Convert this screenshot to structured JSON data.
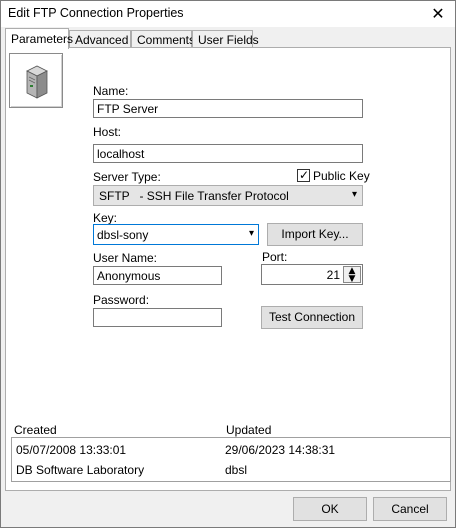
{
  "window": {
    "title": "Edit FTP Connection Properties",
    "close_glyph": "✕"
  },
  "tabs": [
    {
      "label": "Parameters",
      "active": true
    },
    {
      "label": "Advanced",
      "active": false
    },
    {
      "label": "Comments",
      "active": false
    },
    {
      "label": "User Fields",
      "active": false
    }
  ],
  "form": {
    "name_label": "Name:",
    "name_value": "FTP Server",
    "host_label": "Host:",
    "host_value": "localhost",
    "server_type_label": "Server Type:",
    "public_key_label": "Public Key",
    "public_key_checked": true,
    "server_type_value": "SFTP   - SSH File Transfer Protocol",
    "key_label": "Key:",
    "key_value": "dbsl-sony",
    "import_key_button": "Import Key...",
    "user_name_label": "User Name:",
    "user_name_value": "Anonymous",
    "port_label": "Port:",
    "port_value": "21",
    "password_label": "Password:",
    "password_value": "",
    "test_connection_button": "Test Connection"
  },
  "info": {
    "created_label": "Created",
    "updated_label": "Updated",
    "created_date": "05/07/2008 13:33:01",
    "updated_date": "29/06/2023 14:38:31",
    "created_by": "DB Software Laboratory",
    "updated_by": "dbsl"
  },
  "footer": {
    "ok_button": "OK",
    "cancel_button": "Cancel"
  },
  "icons": {
    "main": "server-icon",
    "close": "close-icon",
    "dropdown": "chevron-down-icon",
    "spin": "spin-updown-icon"
  }
}
